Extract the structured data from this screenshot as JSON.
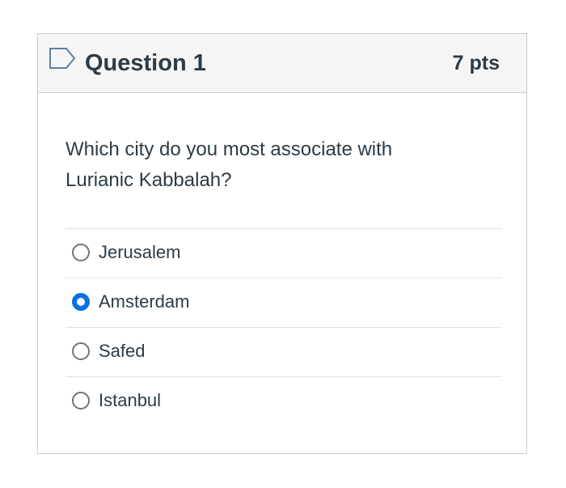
{
  "question": {
    "title": "Question 1",
    "points": "7 pts",
    "flag_icon": "flag-outline-icon",
    "text_line1": "Which city do you most associate with",
    "text_line2": "Lurianic Kabbalah?"
  },
  "answers": [
    {
      "label": "Jerusalem",
      "selected": false
    },
    {
      "label": "Amsterdam",
      "selected": true
    },
    {
      "label": "Safed",
      "selected": false
    },
    {
      "label": "Istanbul",
      "selected": false
    }
  ],
  "colors": {
    "accent": "#0770e3",
    "text": "#2d3b45",
    "header_bg": "#f5f5f5",
    "border": "#c7cdd1"
  }
}
